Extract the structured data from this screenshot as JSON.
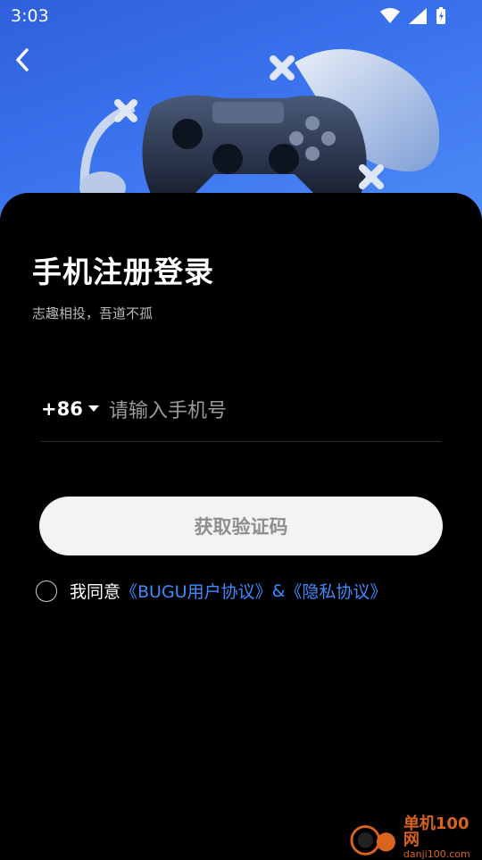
{
  "status_bar": {
    "time": "3:03"
  },
  "header": {
    "back_icon": "chevron-left-icon"
  },
  "hero": {
    "image": "game-controller-illustration"
  },
  "login": {
    "title": "手机注册登录",
    "subtitle": "志趣相投，吾道不孤",
    "country_code": "+86",
    "phone_placeholder": "请输入手机号",
    "get_code_label": "获取验证码",
    "agree_prefix": "我同意",
    "user_agreement": "《BUGU用户协议》",
    "ampersand": "&",
    "privacy_policy": "《隐私协议》"
  },
  "watermark": {
    "title": "单机100网",
    "site": "danji100.com"
  },
  "colors": {
    "accent": "#3d8bff",
    "hero_blue": "#3a72ee",
    "button_bg": "#f2f3f5"
  }
}
